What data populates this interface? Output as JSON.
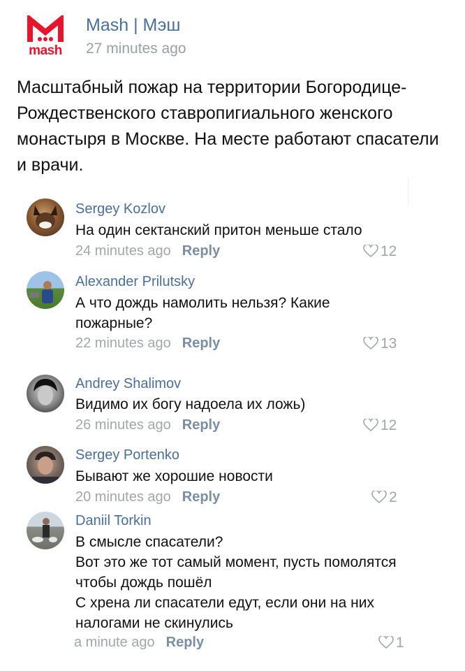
{
  "post": {
    "logo_text": "mash",
    "author": "Mash | Мэш",
    "time": "27 minutes ago",
    "text": "Масштабный пожар на территории Богородице-Рождественского ставропигиального женского монастыря в Москве. На месте работают спасатели и врачи."
  },
  "reply_label": "Reply",
  "colors": {
    "brand": "#e8142c",
    "link": "#4a6f9b",
    "muted": "#a3a7ab"
  },
  "comments": [
    {
      "name": "Sergey Kozlov",
      "text": "На один сектанский притон меньше стало",
      "time": "24 minutes ago",
      "likes": "12",
      "avatar": "dog-avatar"
    },
    {
      "name": "Alexander Prilutsky",
      "text": "А что дождь намолить нельзя? Какие пожарные?",
      "time": "22 minutes ago",
      "likes": "13",
      "avatar": "man-outdoors-avatar"
    },
    {
      "name": "Andrey Shalimov",
      "text": "Видимо их богу надоела их ложь)",
      "time": "26 minutes ago",
      "likes": "12",
      "avatar": "bw-portrait-avatar"
    },
    {
      "name": "Sergey Portenko",
      "text": "Бывают же хорошие новости",
      "time": "20 minutes ago",
      "likes": "2",
      "avatar": "man-portrait-avatar"
    },
    {
      "name": "Daniil Torkin",
      "text": "В смысле спасатели?\nВот это же тот самый момент, пусть помолятся чтобы дождь пошёл\nС хрена ли спасатели едут, если они на них налогами не скинулись",
      "time": "a minute ago",
      "likes": "1",
      "avatar": "dog-walk-avatar"
    }
  ]
}
